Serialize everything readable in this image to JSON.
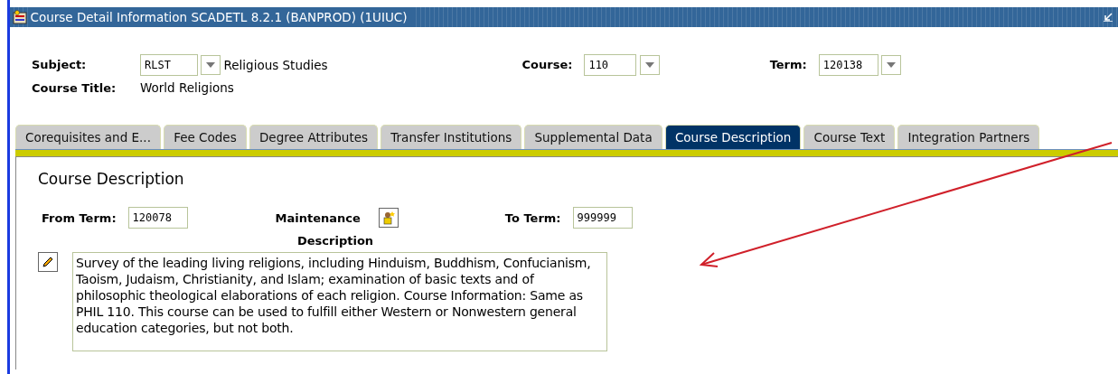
{
  "window": {
    "title": "Course Detail Information  SCADETL  8.2.1  (BANPROD)  (1UIUC)"
  },
  "header": {
    "subject_label": "Subject:",
    "subject_value": "RLST",
    "subject_name": "Religious Studies",
    "course_label": "Course:",
    "course_value": "110",
    "term_label": "Term:",
    "term_value": "120138",
    "title_label": "Course Title:",
    "title_value": "World Religions"
  },
  "tabs": [
    {
      "label": "Corequisites and E...",
      "selected": false
    },
    {
      "label": "Fee Codes",
      "selected": false
    },
    {
      "label": "Degree Attributes",
      "selected": false
    },
    {
      "label": "Transfer Institutions",
      "selected": false
    },
    {
      "label": "Supplemental Data",
      "selected": false
    },
    {
      "label": "Course Description",
      "selected": true
    },
    {
      "label": "Course Text",
      "selected": false
    },
    {
      "label": "Integration Partners",
      "selected": false
    }
  ],
  "panel": {
    "heading": "Course Description",
    "from_term_label": "From Term:",
    "from_term_value": "120078",
    "maintenance_label": "Maintenance",
    "to_term_label": "To Term:",
    "to_term_value": "999999",
    "description_label": "Description",
    "description_value": "Survey of the leading living religions, including Hinduism, Buddhism, Confucianism, Taoism, Judaism, Christianity, and Islam; examination of basic texts and of philosophic theological elaborations of each religion. Course Information: Same as PHIL 110. This course can be used to fulfill either Western or Nonwestern general education categories, but not both."
  }
}
